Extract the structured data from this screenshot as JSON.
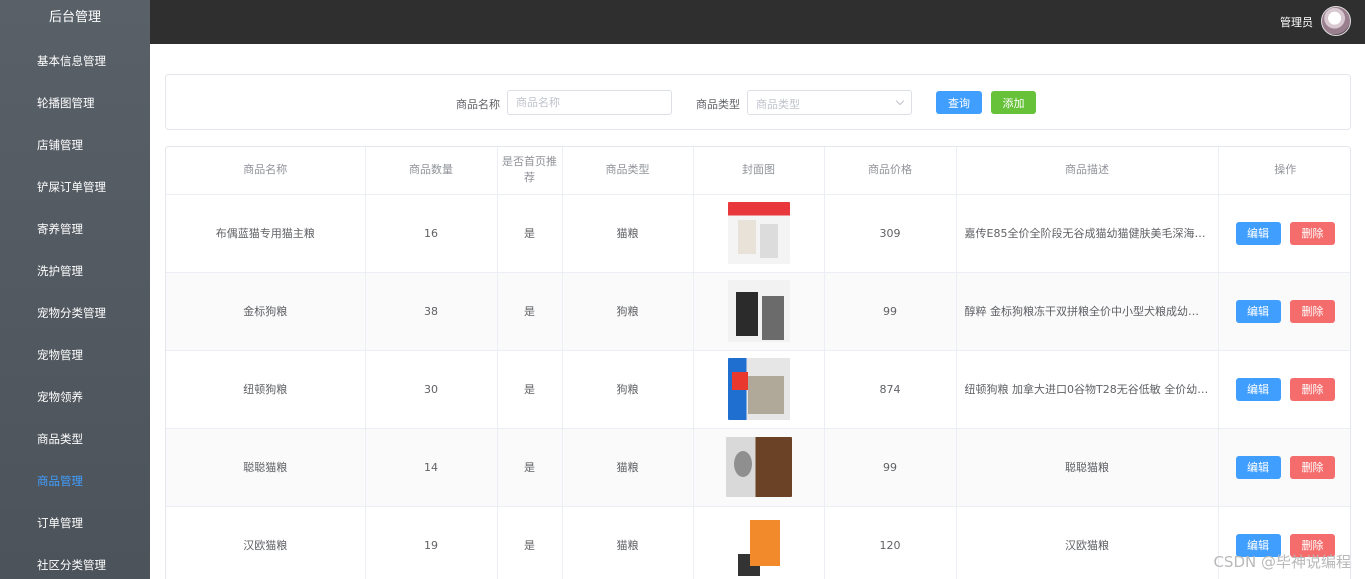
{
  "sidebar": {
    "title": "后台管理",
    "items": [
      {
        "label": "基本信息管理"
      },
      {
        "label": "轮播图管理"
      },
      {
        "label": "店铺管理"
      },
      {
        "label": "铲屎订单管理"
      },
      {
        "label": "寄养管理"
      },
      {
        "label": "洗护管理"
      },
      {
        "label": "宠物分类管理"
      },
      {
        "label": "宠物管理"
      },
      {
        "label": "宠物领养"
      },
      {
        "label": "商品类型"
      },
      {
        "label": "商品管理",
        "active": true
      },
      {
        "label": "订单管理"
      },
      {
        "label": "社区分类管理"
      }
    ]
  },
  "header": {
    "user_name": "管理员",
    "avatar_icon": "user-avatar"
  },
  "search": {
    "name_label": "商品名称",
    "name_placeholder": "商品名称",
    "name_value": "",
    "type_label": "商品类型",
    "type_placeholder": "商品类型",
    "query_label": "查询",
    "add_label": "添加"
  },
  "table": {
    "columns": [
      "商品名称",
      "商品数量",
      "是否首页推荐",
      "商品类型",
      "封面图",
      "商品价格",
      "商品描述",
      "操作"
    ],
    "edit_label": "编辑",
    "delete_label": "删除",
    "rows": [
      {
        "name": "布偶蓝猫专用猫主粮",
        "quantity": "16",
        "recommend": "是",
        "type": "猫粮",
        "price": "309",
        "description": "嘉传E85全价全阶段无谷成猫幼猫健肤美毛深海鱼..."
      },
      {
        "name": "金标狗粮",
        "quantity": "38",
        "recommend": "是",
        "type": "狗粮",
        "price": "99",
        "description": "醇粹 金标狗粮冻干双拼粮全价中小型犬粮成幼犬通..."
      },
      {
        "name": "纽顿狗粮",
        "quantity": "30",
        "recommend": "是",
        "type": "狗粮",
        "price": "874",
        "description": "纽顿狗粮 加拿大进口0谷物T28无谷低敏 全价幼犬..."
      },
      {
        "name": "聪聪猫粮",
        "quantity": "14",
        "recommend": "是",
        "type": "猫粮",
        "price": "99",
        "description": "聪聪猫粮"
      },
      {
        "name": "汉欧猫粮",
        "quantity": "19",
        "recommend": "是",
        "type": "猫粮",
        "price": "120",
        "description": "汉欧猫粮"
      }
    ]
  },
  "colors": {
    "primary": "#409eff",
    "success": "#67c23a",
    "danger": "#f56c6c",
    "sidebar_bg": "#555c63",
    "topbar_bg": "#2f2f2f"
  },
  "watermark": "CSDN @毕神说编程"
}
